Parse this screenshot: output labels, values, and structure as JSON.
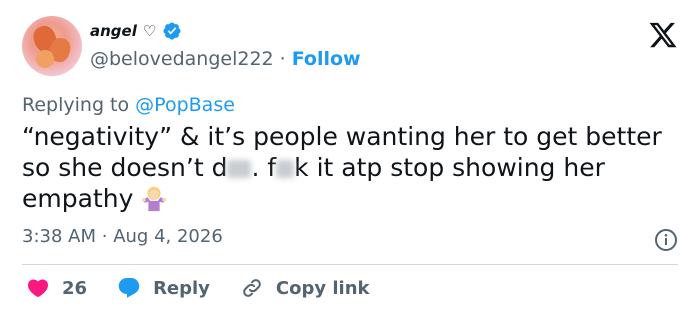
{
  "author": {
    "display_name": "angel",
    "heart_symbol": "♡",
    "handle": "@belovedangel222",
    "separator": "·",
    "follow_label": "Follow"
  },
  "reply_context": {
    "prefix": "Replying to",
    "mention": "@PopBase"
  },
  "tweet": {
    "line1": "“negativity” & it’s people wanting her to get better",
    "line2_a": "so she doesn’t d",
    "line2_b": ". f",
    "line2_c": "k it atp stop showing her",
    "line3": "empathy"
  },
  "meta": {
    "time": "3:38 AM",
    "separator": "·",
    "date": "Aug 4, 2026"
  },
  "actions": {
    "likes_count": "26",
    "reply_label": "Reply",
    "copy_link_label": "Copy link"
  },
  "colors": {
    "accent": "#1d9bf0",
    "like": "#f91880",
    "muted": "#536471",
    "text": "#0f1419",
    "divider": "#cfd9de"
  },
  "icons": {
    "verified": "verified-badge-icon",
    "x_logo": "x-logo-icon",
    "emoji": "person-shrugging-emoji",
    "info": "info-icon",
    "like": "heart-icon",
    "reply": "reply-bubble-icon",
    "link": "link-icon"
  }
}
